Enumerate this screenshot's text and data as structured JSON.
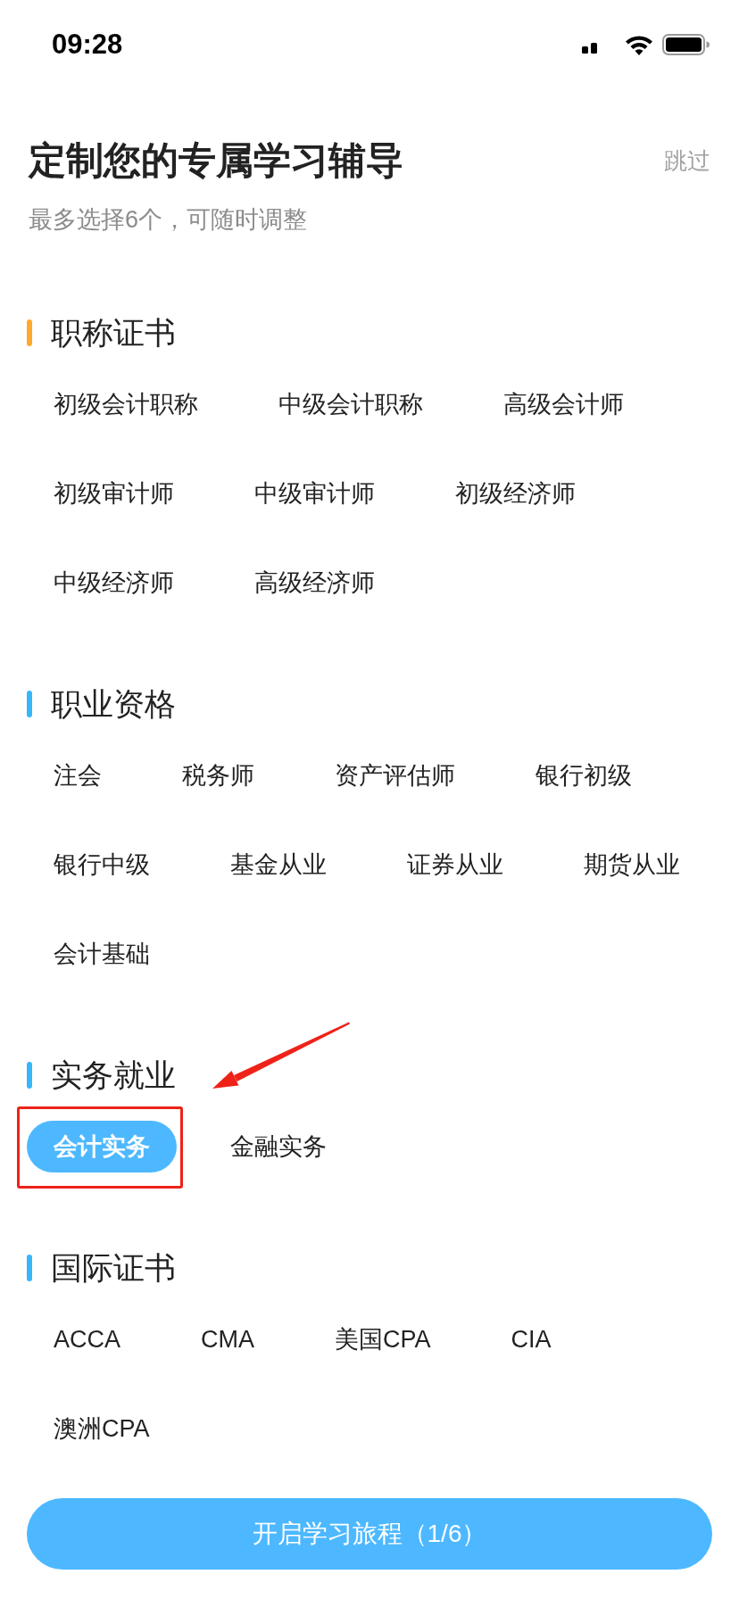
{
  "status_bar": {
    "time": "09:28"
  },
  "header": {
    "title": "定制您的专属学习辅导",
    "skip": "跳过",
    "subtitle": "最多选择6个，可随时调整"
  },
  "sections": [
    {
      "title": "职称证书",
      "color": "#ffaa2c",
      "options": [
        {
          "label": "初级会计职称",
          "selected": false,
          "marked": false
        },
        {
          "label": "中级会计职称",
          "selected": false,
          "marked": false
        },
        {
          "label": "高级会计师",
          "selected": false,
          "marked": false
        },
        {
          "label": "初级审计师",
          "selected": false,
          "marked": false
        },
        {
          "label": "中级审计师",
          "selected": false,
          "marked": false
        },
        {
          "label": "初级经济师",
          "selected": false,
          "marked": false
        },
        {
          "label": "中级经济师",
          "selected": false,
          "marked": false
        },
        {
          "label": "高级经济师",
          "selected": false,
          "marked": false
        }
      ]
    },
    {
      "title": "职业资格",
      "color": "#37b6fa",
      "options": [
        {
          "label": "注会",
          "selected": false,
          "marked": false
        },
        {
          "label": "税务师",
          "selected": false,
          "marked": false
        },
        {
          "label": "资产评估师",
          "selected": false,
          "marked": false
        },
        {
          "label": "银行初级",
          "selected": false,
          "marked": false
        },
        {
          "label": "银行中级",
          "selected": false,
          "marked": false
        },
        {
          "label": "基金从业",
          "selected": false,
          "marked": false
        },
        {
          "label": "证券从业",
          "selected": false,
          "marked": false
        },
        {
          "label": "期货从业",
          "selected": false,
          "marked": false
        },
        {
          "label": "会计基础",
          "selected": false,
          "marked": false
        }
      ]
    },
    {
      "title": "实务就业",
      "color": "#37b6fa",
      "options": [
        {
          "label": "会计实务",
          "selected": true,
          "marked": true
        },
        {
          "label": "金融实务",
          "selected": false,
          "marked": false
        }
      ]
    },
    {
      "title": "国际证书",
      "color": "#37b6fa",
      "options": [
        {
          "label": "ACCA",
          "selected": false,
          "marked": false
        },
        {
          "label": "CMA",
          "selected": false,
          "marked": false
        },
        {
          "label": "美国CPA",
          "selected": false,
          "marked": false
        },
        {
          "label": "CIA",
          "selected": false,
          "marked": false
        },
        {
          "label": "澳洲CPA",
          "selected": false,
          "marked": false
        }
      ]
    }
  ],
  "start_button": {
    "label": "开启学习旅程（1/6）"
  }
}
